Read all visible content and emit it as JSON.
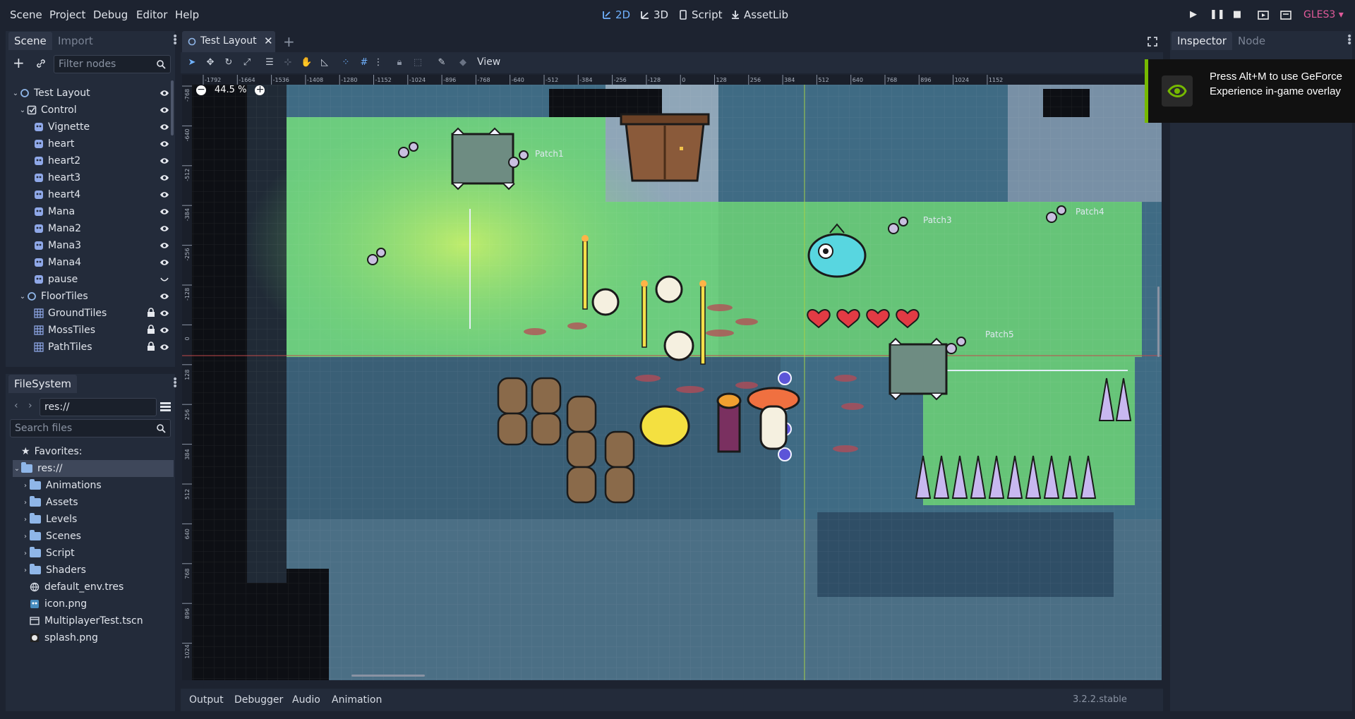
{
  "menubar": {
    "menus": [
      "Scene",
      "Project",
      "Debug",
      "Editor",
      "Help"
    ],
    "workspaces": [
      "2D",
      "3D",
      "Script",
      "AssetLib"
    ],
    "renderer": "GLES3"
  },
  "scene_dock": {
    "tabs": [
      "Scene",
      "Import"
    ],
    "filter_placeholder": "Filter nodes",
    "nodes": [
      {
        "label": "Test Layout",
        "depth": 0,
        "type": "root"
      },
      {
        "label": "Control",
        "depth": 1,
        "type": "control"
      },
      {
        "label": "Vignette",
        "depth": 2,
        "type": "sprite"
      },
      {
        "label": "heart",
        "depth": 2,
        "type": "sprite"
      },
      {
        "label": "heart2",
        "depth": 2,
        "type": "sprite"
      },
      {
        "label": "heart3",
        "depth": 2,
        "type": "sprite"
      },
      {
        "label": "heart4",
        "depth": 2,
        "type": "sprite"
      },
      {
        "label": "Mana",
        "depth": 2,
        "type": "sprite"
      },
      {
        "label": "Mana2",
        "depth": 2,
        "type": "sprite"
      },
      {
        "label": "Mana3",
        "depth": 2,
        "type": "sprite"
      },
      {
        "label": "Mana4",
        "depth": 2,
        "type": "sprite"
      },
      {
        "label": "pause",
        "depth": 2,
        "type": "sprite"
      },
      {
        "label": "FloorTiles",
        "depth": 1,
        "type": "node"
      },
      {
        "label": "GroundTiles",
        "depth": 2,
        "type": "tilemap"
      },
      {
        "label": "MossTiles",
        "depth": 2,
        "type": "tilemap"
      },
      {
        "label": "PathTiles",
        "depth": 2,
        "type": "tilemap"
      }
    ]
  },
  "filesystem_dock": {
    "tab": "FileSystem",
    "path": "res://",
    "search_placeholder": "Search files",
    "favorites": "Favorites:",
    "root": "res://",
    "folders": [
      "Animations",
      "Assets",
      "Levels",
      "Scenes",
      "Script",
      "Shaders"
    ],
    "files": [
      "default_env.tres",
      "icon.png",
      "MultiplayerTest.tscn",
      "splash.png"
    ]
  },
  "editor": {
    "scene_tab": "Test Layout",
    "view_menu": "View",
    "zoom": "44.5 %",
    "ruler_x": [
      "-1792",
      "-1664",
      "-1536",
      "-1408",
      "-1280",
      "-1152",
      "-1024",
      "-896",
      "-768",
      "-640",
      "-512",
      "-384",
      "-256",
      "-128",
      "0",
      "128",
      "256",
      "384",
      "512",
      "640",
      "768",
      "896",
      "1024",
      "1152"
    ],
    "ruler_y": [
      "-768",
      "-640",
      "-512",
      "-384",
      "-256",
      "-128",
      "0",
      "128",
      "256",
      "384",
      "512",
      "640",
      "768",
      "896",
      "1024"
    ],
    "labels": [
      "Patch1",
      "Patch3",
      "Patch4",
      "Patch5"
    ]
  },
  "bottom_panel": {
    "tabs": [
      "Output",
      "Debugger",
      "Audio",
      "Animation"
    ],
    "version": "3.2.2.stable"
  },
  "inspector_dock": {
    "tabs": [
      "Inspector",
      "Node"
    ]
  },
  "overlay": {
    "text": "Press Alt+M to use GeForce Experience in-game overlay"
  },
  "colors": {
    "accent": "#70b2ff",
    "renderer": "#e05a9a",
    "nvidia": "#76b900"
  }
}
